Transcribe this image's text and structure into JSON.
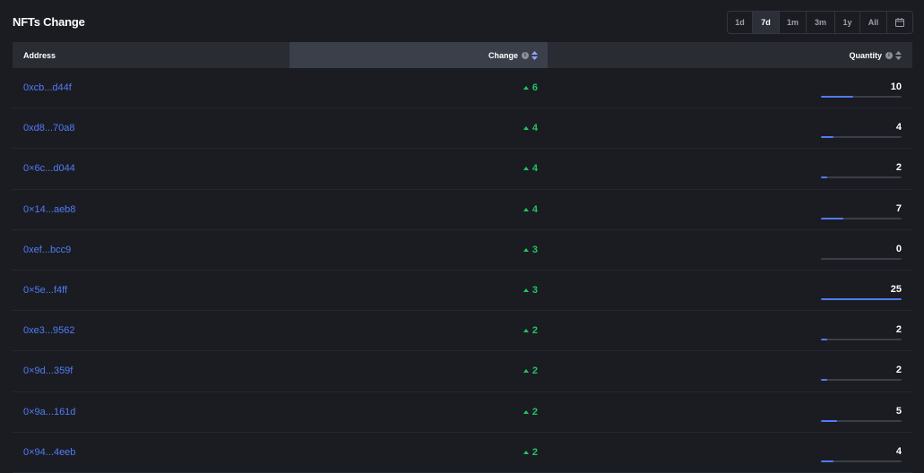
{
  "header": {
    "title": "NFTs Change"
  },
  "time_range": {
    "options": [
      "1d",
      "7d",
      "1m",
      "3m",
      "1y",
      "All"
    ],
    "active": "7d",
    "calendar_icon": "calendar-icon"
  },
  "table": {
    "columns": {
      "address": "Address",
      "change": "Change",
      "quantity": "Quantity"
    },
    "rows": [
      {
        "address": "0xcb...d44f",
        "change": "6",
        "quantity": "10",
        "qty_fraction": 0.4
      },
      {
        "address": "0xd8...70a8",
        "change": "4",
        "quantity": "4",
        "qty_fraction": 0.16
      },
      {
        "address": "0×6c...d044",
        "change": "4",
        "quantity": "2",
        "qty_fraction": 0.08
      },
      {
        "address": "0×14...aeb8",
        "change": "4",
        "quantity": "7",
        "qty_fraction": 0.28
      },
      {
        "address": "0xef...bcc9",
        "change": "3",
        "quantity": "0",
        "qty_fraction": 0
      },
      {
        "address": "0×5e...f4ff",
        "change": "3",
        "quantity": "25",
        "qty_fraction": 1.0
      },
      {
        "address": "0xe3...9562",
        "change": "2",
        "quantity": "2",
        "qty_fraction": 0.08
      },
      {
        "address": "0×9d...359f",
        "change": "2",
        "quantity": "2",
        "qty_fraction": 0.08
      },
      {
        "address": "0×9a...161d",
        "change": "2",
        "quantity": "5",
        "qty_fraction": 0.2
      },
      {
        "address": "0×94...4eeb",
        "change": "2",
        "quantity": "4",
        "qty_fraction": 0.16
      }
    ]
  },
  "colors": {
    "accent": "#4f7cf7",
    "positive": "#22c55e",
    "background": "#1b1c22"
  }
}
